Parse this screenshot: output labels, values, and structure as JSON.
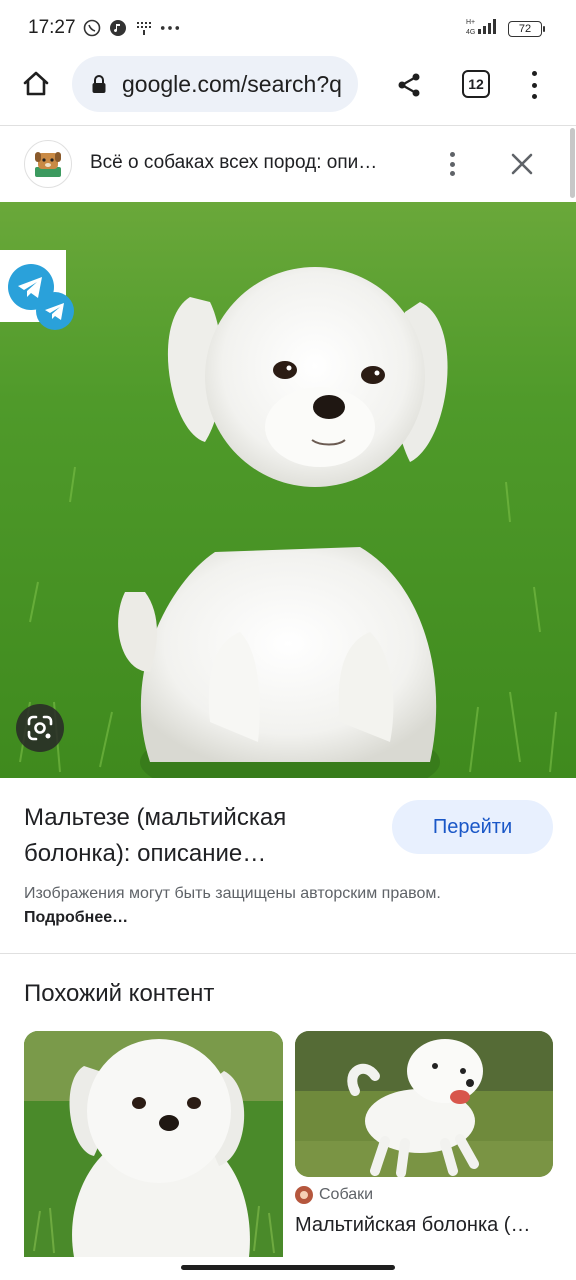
{
  "status_bar": {
    "time": "17:27",
    "battery": "72",
    "network": "H+ 4G"
  },
  "toolbar": {
    "url": "google.com/search?q",
    "tabs_count": "12"
  },
  "source_bar": {
    "title": "Всё о собаках всех пород: опи…"
  },
  "result": {
    "title": "Мальтезе (мальтийская болонка): описание…",
    "go_label": "Перейти",
    "copyright_text": "Изображения могут быть защищены авторским правом. ",
    "copyright_more": "Подробнее…"
  },
  "similar": {
    "heading": "Похожий контент",
    "cards": [
      {
        "source": "",
        "caption": ""
      },
      {
        "source": "Собаки",
        "caption": "Мальтийская болонка (…"
      }
    ]
  },
  "icons": {
    "home": "home-icon",
    "lock": "lock-icon",
    "share": "share-icon",
    "menu": "more-vert-icon",
    "close": "close-icon",
    "lens": "google-lens-icon",
    "telegram": "telegram-icon"
  },
  "colors": {
    "accent": "#1a57c7",
    "button_bg": "#e8f0fe",
    "url_bg": "#edf1f8"
  }
}
